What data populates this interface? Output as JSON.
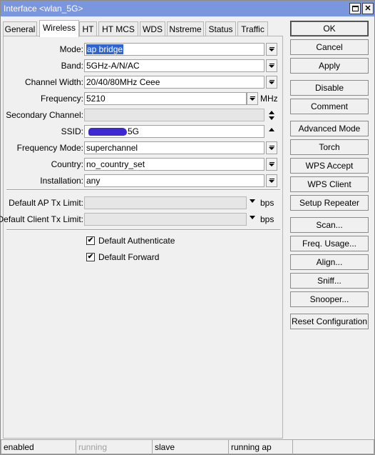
{
  "window": {
    "title": "Interface <wlan_5G>"
  },
  "tabs": [
    {
      "label": "General",
      "active": false
    },
    {
      "label": "Wireless",
      "active": true
    },
    {
      "label": "HT",
      "active": false
    },
    {
      "label": "HT MCS",
      "active": false
    },
    {
      "label": "WDS",
      "active": false
    },
    {
      "label": "Nstreme",
      "active": false
    },
    {
      "label": "Status",
      "active": false
    },
    {
      "label": "Traffic",
      "active": false
    }
  ],
  "form": {
    "mode": {
      "label": "Mode:",
      "value": "ap bridge"
    },
    "band": {
      "label": "Band:",
      "value": "5GHz-A/N/AC"
    },
    "channel_width": {
      "label": "Channel Width:",
      "value": "20/40/80MHz Ceee"
    },
    "frequency": {
      "label": "Frequency:",
      "value": "5210",
      "unit": "MHz"
    },
    "secondary_channel": {
      "label": "Secondary Channel:",
      "value": ""
    },
    "ssid": {
      "label": "SSID:",
      "value": "5G"
    },
    "frequency_mode": {
      "label": "Frequency Mode:",
      "value": "superchannel"
    },
    "country": {
      "label": "Country:",
      "value": "no_country_set"
    },
    "installation": {
      "label": "Installation:",
      "value": "any"
    },
    "default_ap_tx_limit": {
      "label": "Default AP Tx Limit:",
      "value": "",
      "unit": "bps"
    },
    "default_client_tx_limit": {
      "label": "Default Client Tx Limit:",
      "value": "",
      "unit": "bps"
    },
    "default_authenticate": {
      "label": "Default Authenticate",
      "checked": true,
      "mark": "✔"
    },
    "default_forward": {
      "label": "Default Forward",
      "checked": true,
      "mark": "✔"
    }
  },
  "buttons": {
    "ok": "OK",
    "cancel": "Cancel",
    "apply": "Apply",
    "disable": "Disable",
    "comment": "Comment",
    "advanced_mode": "Advanced Mode",
    "torch": "Torch",
    "wps_accept": "WPS Accept",
    "wps_client": "WPS Client",
    "setup_repeater": "Setup Repeater",
    "scan": "Scan...",
    "freq_usage": "Freq. Usage...",
    "align": "Align...",
    "sniff": "Sniff...",
    "snooper": "Snooper...",
    "reset_configuration": "Reset Configuration"
  },
  "status_bar": [
    "enabled",
    "running",
    "slave",
    "running ap",
    ""
  ],
  "colors": {
    "titlebar": "#7a96df",
    "selection": "#3065d0",
    "ssid_redaction": "#3d28d4"
  }
}
